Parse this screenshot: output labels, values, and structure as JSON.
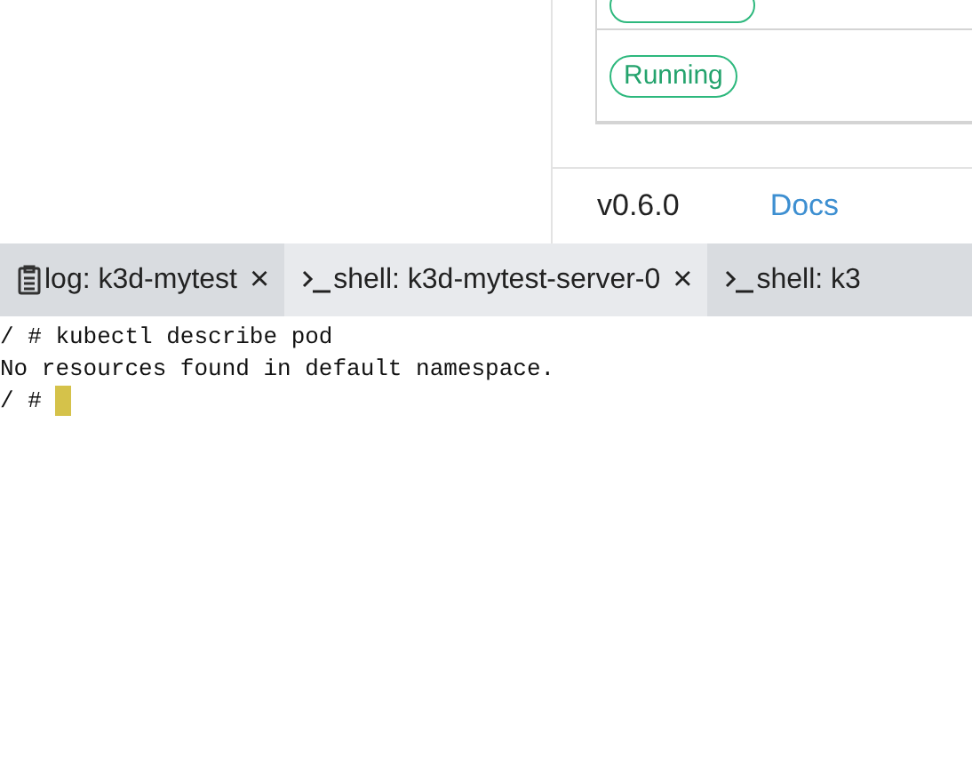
{
  "pod_table": {
    "rows": [
      {
        "kind": "partial"
      },
      {
        "kind": "full",
        "status": "Running"
      }
    ]
  },
  "footer": {
    "version": "v0.6.0",
    "link": "Docs"
  },
  "tabs": [
    {
      "kind": "log",
      "label": "log: k3d-mytest",
      "close": "×",
      "selected": false
    },
    {
      "kind": "shell",
      "label": "shell: k3d-mytest-server-0",
      "close": "×",
      "selected": true
    },
    {
      "kind": "shell",
      "label": "shell: k3",
      "selected": false
    }
  ],
  "terminal": {
    "lines": [
      "/ # kubectl describe pod",
      "No resources found in default namespace."
    ],
    "prompt": "/ #",
    "cursor": true
  }
}
